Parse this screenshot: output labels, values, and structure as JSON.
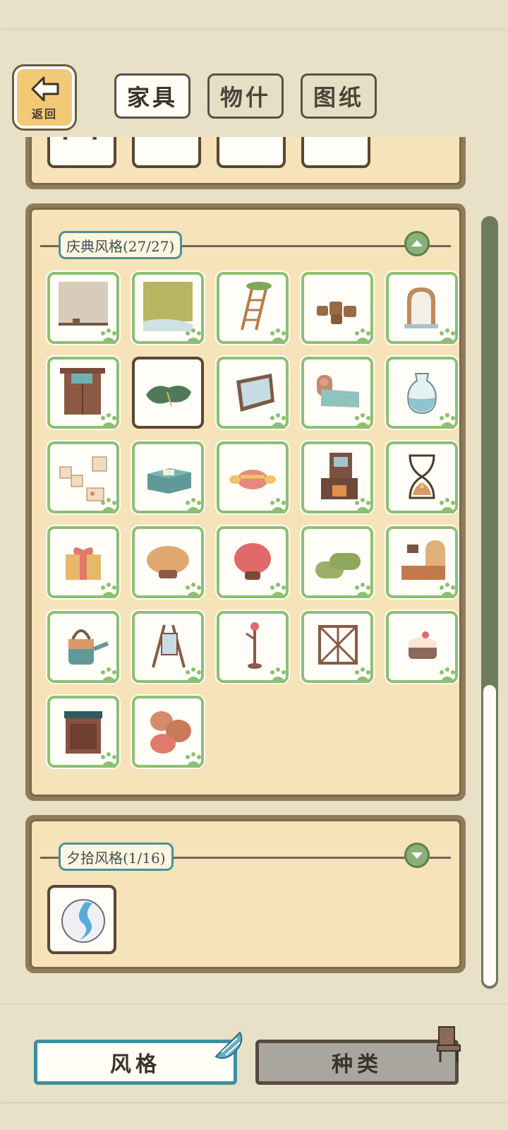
{
  "header": {
    "back_label": "返回",
    "tabs": [
      {
        "label": "家具",
        "active": true
      },
      {
        "label": "物什",
        "active": false
      },
      {
        "label": "图纸",
        "active": false
      }
    ]
  },
  "sections": [
    {
      "title": "庆典风格(27/27)",
      "expanded": true,
      "toggle_icon": "chevron-up-icon",
      "items": [
        "wall-wallpaper-icon",
        "grass-floor-icon",
        "wooden-ladder-icon",
        "log-stools-icon",
        "arched-window-icon",
        "wooden-door-icon",
        "green-sleeping-bag-icon",
        "mirror-panel-icon",
        "bed-icon",
        "glass-vase-icon",
        "memo-board-icon",
        "tool-chest-icon",
        "candy-cushion-icon",
        "fireplace-shelf-icon",
        "hourglass-icon",
        "gift-box-icon",
        "mushroom-stool-tan-icon",
        "mushroom-stool-red-icon",
        "rolled-mats-icon",
        "kitchen-oven-icon",
        "watering-can-icon",
        "easel-mirror-icon",
        "coat-rack-icon",
        "wooden-fence-icon",
        "cake-icon",
        "wooden-cabinet-icon",
        "sack-pile-icon"
      ]
    },
    {
      "title": "夕拾风格(1/16)",
      "expanded": true,
      "toggle_icon": "chevron-down-icon",
      "items": [
        "marble-icon"
      ]
    }
  ],
  "bottom_tabs": [
    {
      "label": "风格",
      "active": true,
      "icon": "seashell-icon"
    },
    {
      "label": "种类",
      "active": false,
      "icon": "chair-icon"
    }
  ],
  "colors": {
    "background": "#e8e1c8",
    "panel": "#f7e3b9",
    "tile_border": "#8dbf73",
    "label_border": "#4c8f98",
    "scrollbar": "#6e7a5d"
  }
}
